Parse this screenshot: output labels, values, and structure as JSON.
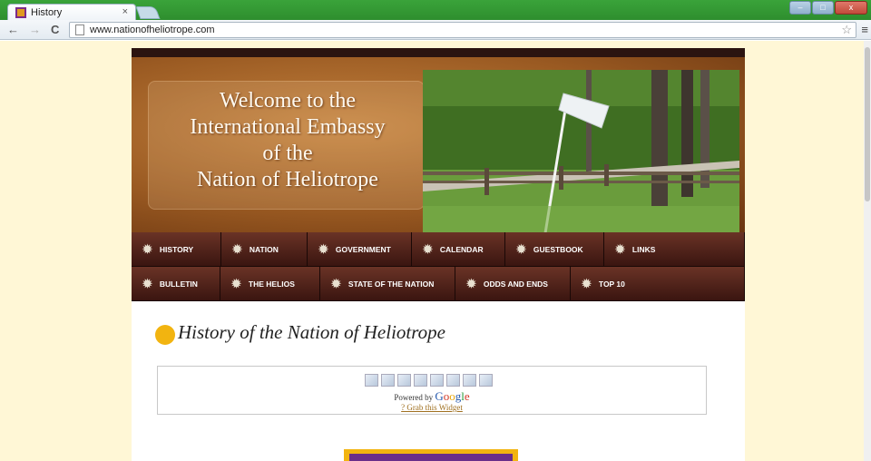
{
  "browser": {
    "tab_title": "History",
    "tab_close": "×",
    "url": "www.nationofheliotrope.com",
    "back": "←",
    "forward": "→",
    "reload": "C",
    "star": "☆",
    "menu": "≡",
    "win_min": "–",
    "win_max": "□",
    "win_close": "x"
  },
  "banner": {
    "line1": "Welcome to the",
    "line2": "International Embassy",
    "line3": "of the",
    "line4": "Nation of Heliotrope"
  },
  "nav": {
    "row1": [
      "HISTORY",
      "NATION",
      "GOVERNMENT",
      "CALENDAR",
      "GUESTBOOK",
      "LINKS"
    ],
    "row2": [
      "BULLETIN",
      "THE HELIOS",
      "STATE OF THE NATION",
      "ODDS AND ENDS",
      "TOP 10"
    ]
  },
  "content": {
    "heading": "History of the Nation of Heliotrope",
    "powered_by": "Powered by",
    "google": [
      "G",
      "o",
      "o",
      "g",
      "l",
      "e"
    ],
    "grab_widget": "? Grab this Widget"
  },
  "colors": {
    "page_bg": "#fff7d6",
    "nav_bg": "#3a1510",
    "bullet": "#f2b410",
    "footer_box": "#6a2e8a"
  }
}
